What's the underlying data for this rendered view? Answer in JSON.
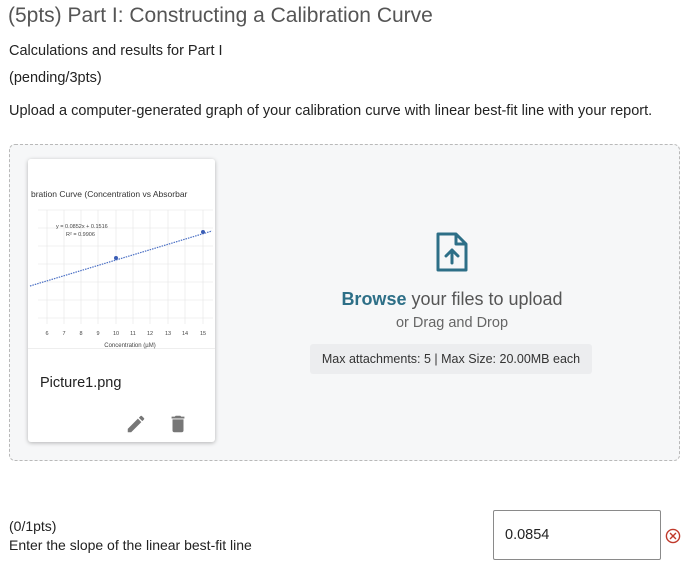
{
  "section": {
    "title": "(5pts) Part I: Constructing a Calibration Curve",
    "subtitle": "Calculations and results for Part I",
    "points_status": "(pending/3pts)",
    "instruction": "Upload a computer-generated graph of your calibration curve with linear best-fit line with your report."
  },
  "attachment": {
    "file_name": "Picture1.png",
    "edit_icon": "pencil-icon",
    "delete_icon": "trash-icon",
    "thumbnail": {
      "title": "bration Curve (Concentration vs Absorbar",
      "equation": "y = 0.0852x + 0.1516",
      "r_squared": "R² = 0.9906",
      "x_ticks": [
        "6",
        "7",
        "8",
        "9",
        "10",
        "11",
        "12",
        "13",
        "14",
        "15"
      ],
      "xlabel": "Concentration (µM)"
    }
  },
  "upload": {
    "icon": "file-upload-icon",
    "browse_link": "Browse",
    "browse_rest": " your files to upload",
    "or_text": "or Drag and Drop",
    "max_info": "Max attachments: 5 | Max Size: 20.00MB each"
  },
  "question": {
    "points": "(0/1pts)",
    "text": "Enter the slope of the linear best-fit line",
    "answer": "0.0854",
    "status_icon": "incorrect-circle-x-icon",
    "status_color": "#c0392b"
  },
  "colors": {
    "accent": "#2d6f87",
    "trendline": "#4a6fc4"
  }
}
